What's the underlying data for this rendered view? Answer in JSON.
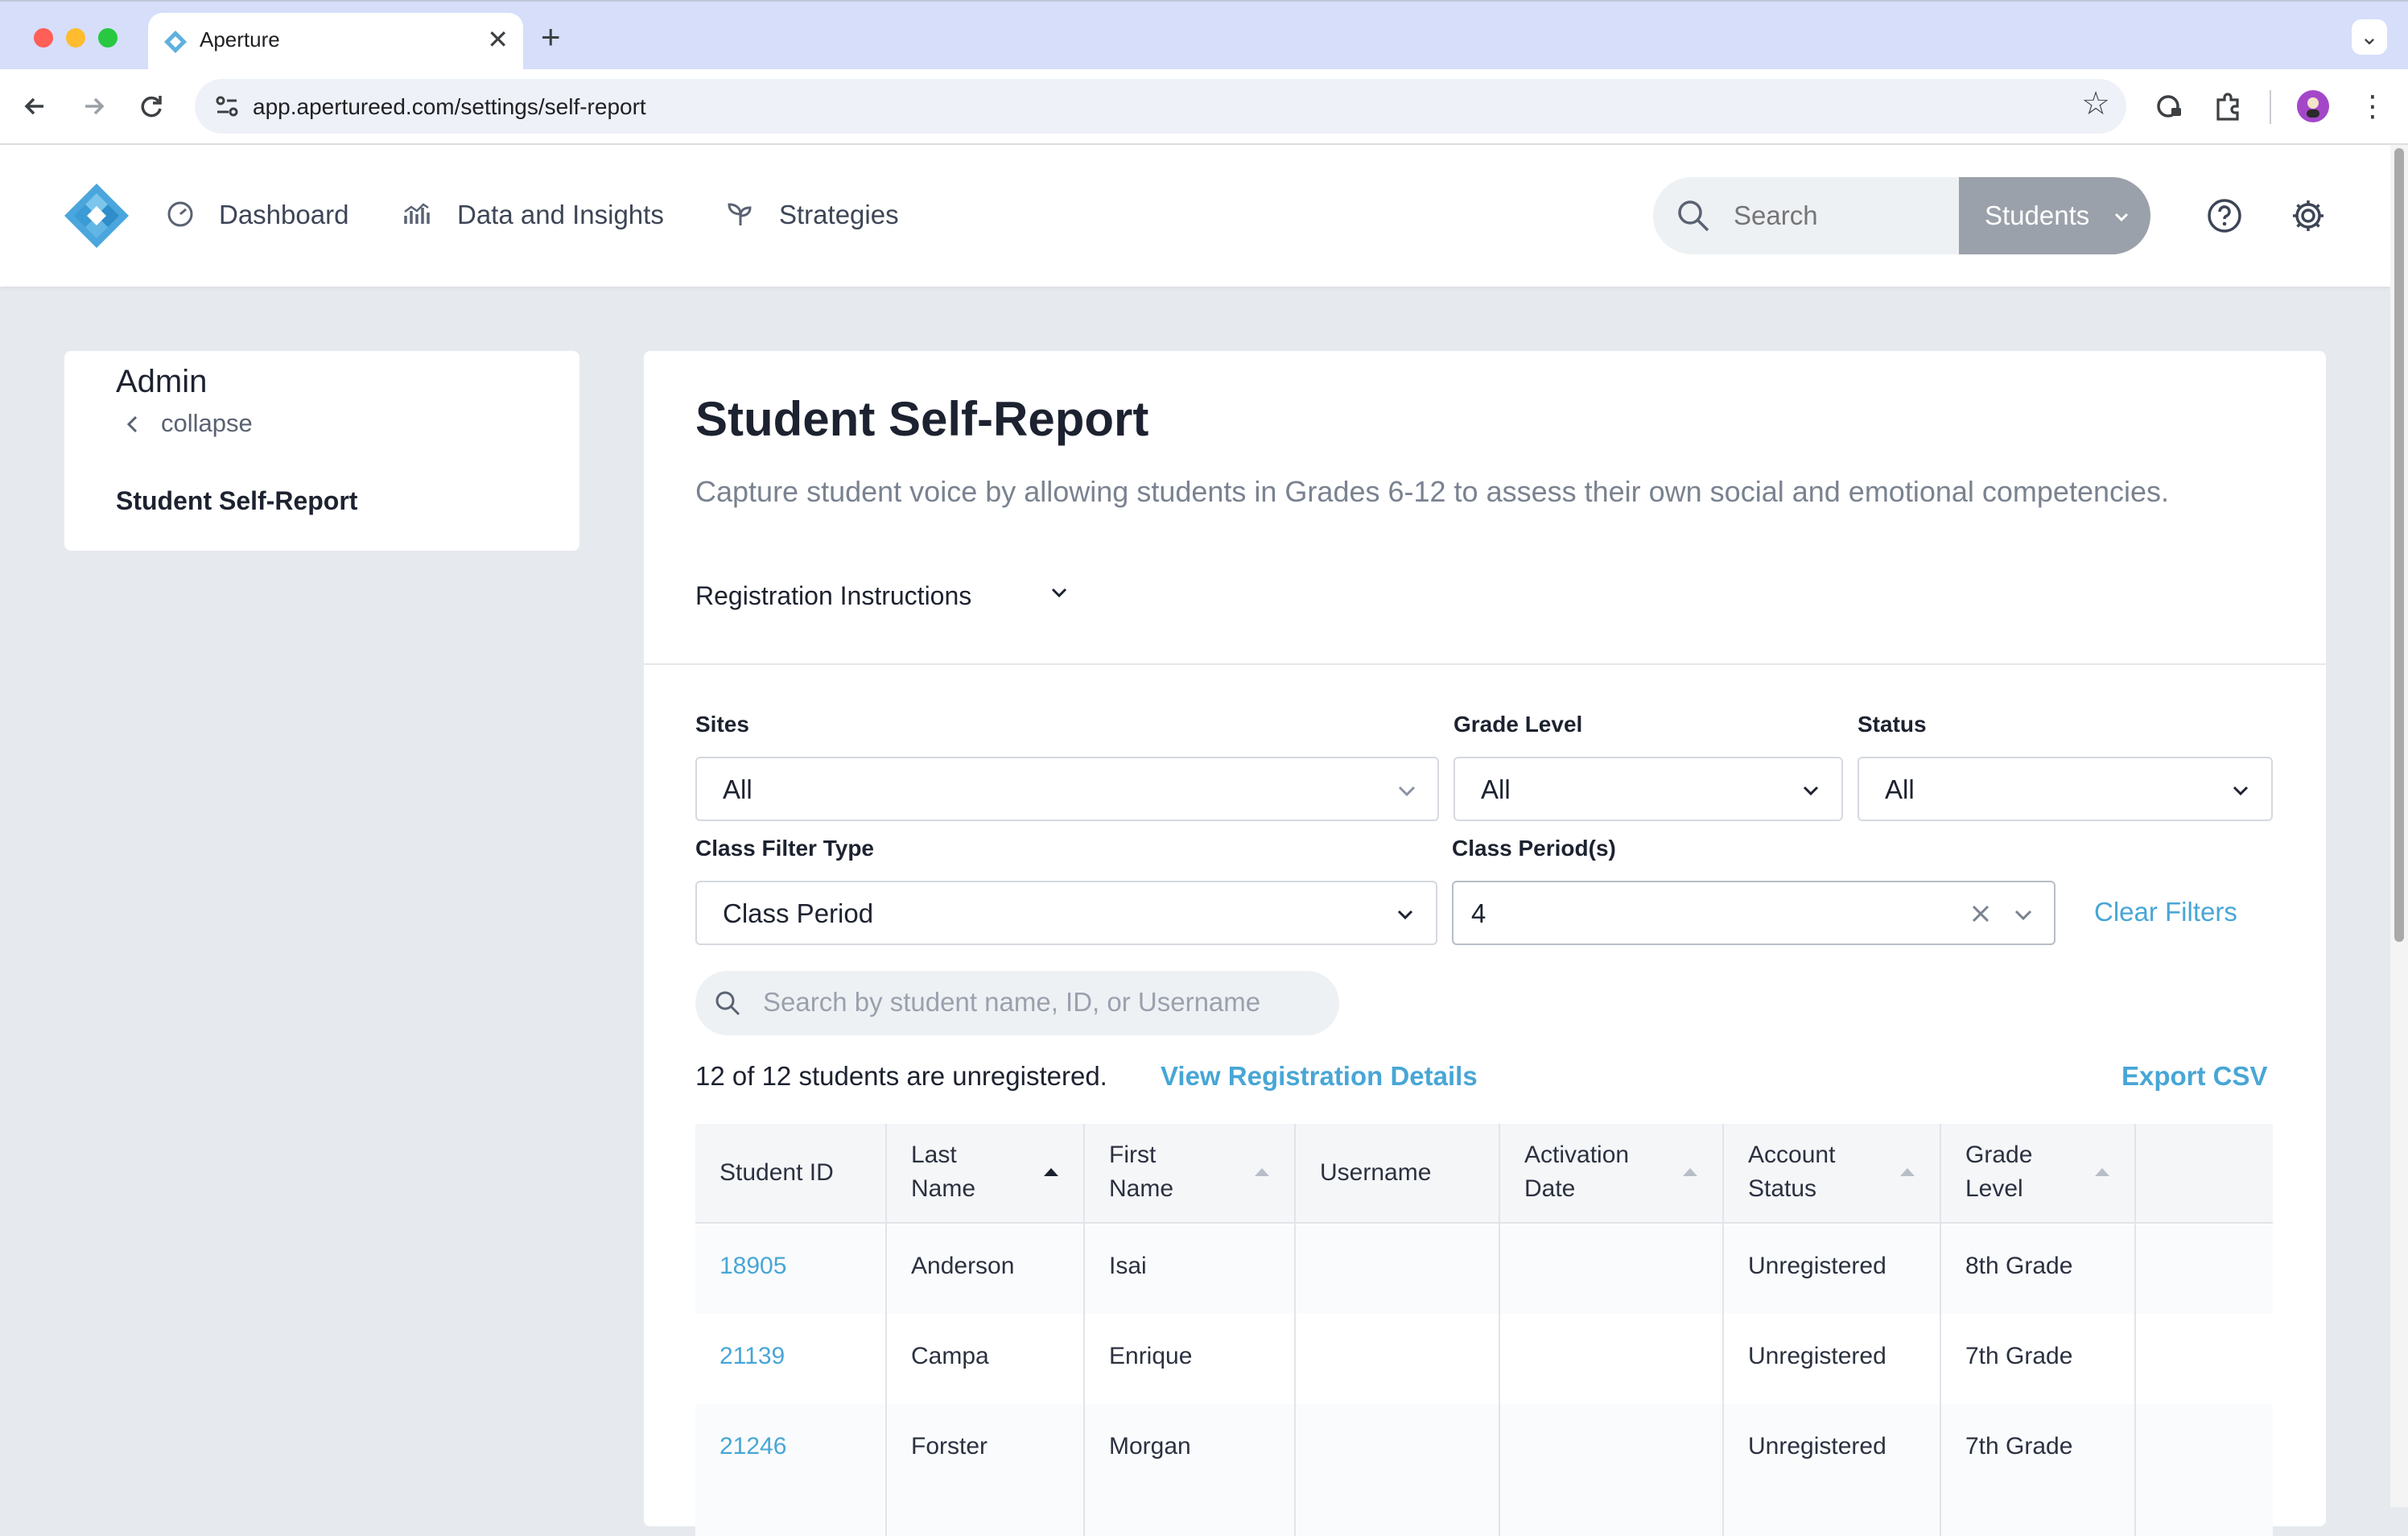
{
  "browser": {
    "tab_title": "Aperture",
    "url": "app.apertureed.com/settings/self-report",
    "tab_close": "✕",
    "new_tab": "+"
  },
  "header": {
    "nav": [
      {
        "label": "Dashboard",
        "icon": "dashboard-gauge-icon"
      },
      {
        "label": "Data and Insights",
        "icon": "bar-chart-icon"
      },
      {
        "label": "Strategies",
        "icon": "sprout-icon"
      }
    ],
    "search_placeholder": "Search",
    "scope_button": "Students"
  },
  "sidebar": {
    "title": "Admin",
    "collapse": "collapse",
    "items": [
      {
        "label": "Student Self-Report"
      }
    ]
  },
  "main": {
    "title": "Student Self-Report",
    "description": "Capture student voice by allowing students in Grades 6-12 to assess their own social and emotional competencies.",
    "registration_instructions": "Registration Instructions",
    "filters": {
      "sites": {
        "label": "Sites",
        "value": "All"
      },
      "grade_level": {
        "label": "Grade Level",
        "value": "All"
      },
      "status": {
        "label": "Status",
        "value": "All"
      },
      "class_filter_type": {
        "label": "Class Filter Type",
        "value": "Class Period"
      },
      "class_periods": {
        "label": "Class Period(s)",
        "value": "4"
      },
      "clear": "Clear Filters"
    },
    "student_search_placeholder": "Search by student name, ID, or Username",
    "summary": "12 of 12 students are unregistered.",
    "view_details": "View Registration Details",
    "export": "Export CSV",
    "table": {
      "columns": [
        "Student ID",
        "Last\nName",
        "First\nName",
        "Username",
        "Activation\nDate",
        "Account\nStatus",
        "Grade\nLevel"
      ],
      "col_line1": [
        "Student ID",
        "Last",
        "First",
        "Username",
        "Activation",
        "Account",
        "Grade"
      ],
      "col_line2": [
        "",
        "Name",
        "Name",
        "",
        "Date",
        "Status",
        "Level"
      ],
      "rows": [
        {
          "id": "18905",
          "last": "Anderson",
          "first": "Isai",
          "username": "",
          "activation": "",
          "status": "Unregistered",
          "grade": "8th Grade"
        },
        {
          "id": "21139",
          "last": "Campa",
          "first": "Enrique",
          "username": "",
          "activation": "",
          "status": "Unregistered",
          "grade": "7th Grade"
        },
        {
          "id": "21246",
          "last": "Forster",
          "first": "Morgan",
          "username": "",
          "activation": "",
          "status": "Unregistered",
          "grade": "7th Grade"
        }
      ]
    }
  },
  "colors": {
    "accent": "#48a6d6",
    "scope_button": "#9ba1aa",
    "page_bg": "#e6eaee"
  }
}
